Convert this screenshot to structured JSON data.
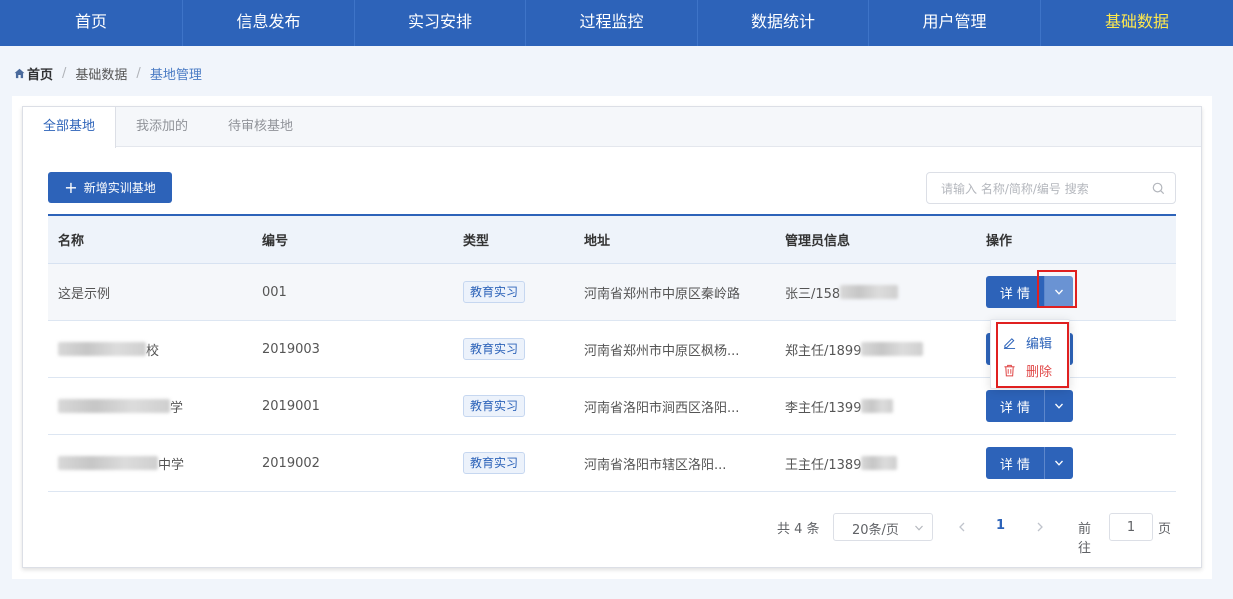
{
  "nav": {
    "items": [
      {
        "label": "首页",
        "active": false
      },
      {
        "label": "信息发布",
        "active": false
      },
      {
        "label": "实习安排",
        "active": false
      },
      {
        "label": "过程监控",
        "active": false
      },
      {
        "label": "数据统计",
        "active": false
      },
      {
        "label": "用户管理",
        "active": false
      },
      {
        "label": "基础数据",
        "active": true
      }
    ]
  },
  "breadcrumb": {
    "home": "首页",
    "separator": "/",
    "level1": "基础数据",
    "current": "基地管理"
  },
  "tabs": [
    {
      "label": "全部基地",
      "active": true
    },
    {
      "label": "我添加的",
      "active": false
    },
    {
      "label": "待审核基地",
      "active": false
    }
  ],
  "toolbar": {
    "add_label": "新增实训基地",
    "search_placeholder": "请输入 名称/简称/编号 搜索"
  },
  "table": {
    "headers": [
      "名称",
      "编号",
      "类型",
      "地址",
      "管理员信息",
      "操作"
    ],
    "rows": [
      {
        "name": "这是示例",
        "code": "001",
        "type": "教育实习",
        "address": "河南省郑州市中原区秦岭路",
        "admin": "张三/158"
      },
      {
        "name": "校",
        "code": "2019003",
        "type": "教育实习",
        "address": "河南省郑州市中原区枫杨...",
        "admin": "郑主任/1899"
      },
      {
        "name": "学",
        "code": "2019001",
        "type": "教育实习",
        "address": "河南省洛阳市涧西区洛阳...",
        "admin": "李主任/1399"
      },
      {
        "name": "中学",
        "code": "2019002",
        "type": "教育实习",
        "address": "河南省洛阳市辖区洛阳...",
        "admin": "王主任/1389"
      }
    ],
    "detail_label": "详 情"
  },
  "dropdown": {
    "edit_label": "编辑",
    "delete_label": "删除"
  },
  "pagination": {
    "total": "共 4 条",
    "page_size": "20条/页",
    "current_page": "1",
    "goto_label": "前往",
    "goto_value": "1",
    "page_suffix": "页"
  },
  "colors": {
    "primary": "#2d63b9",
    "nav_active": "#ffe94c",
    "highlight_box": "#e02020",
    "danger": "#e04848"
  }
}
